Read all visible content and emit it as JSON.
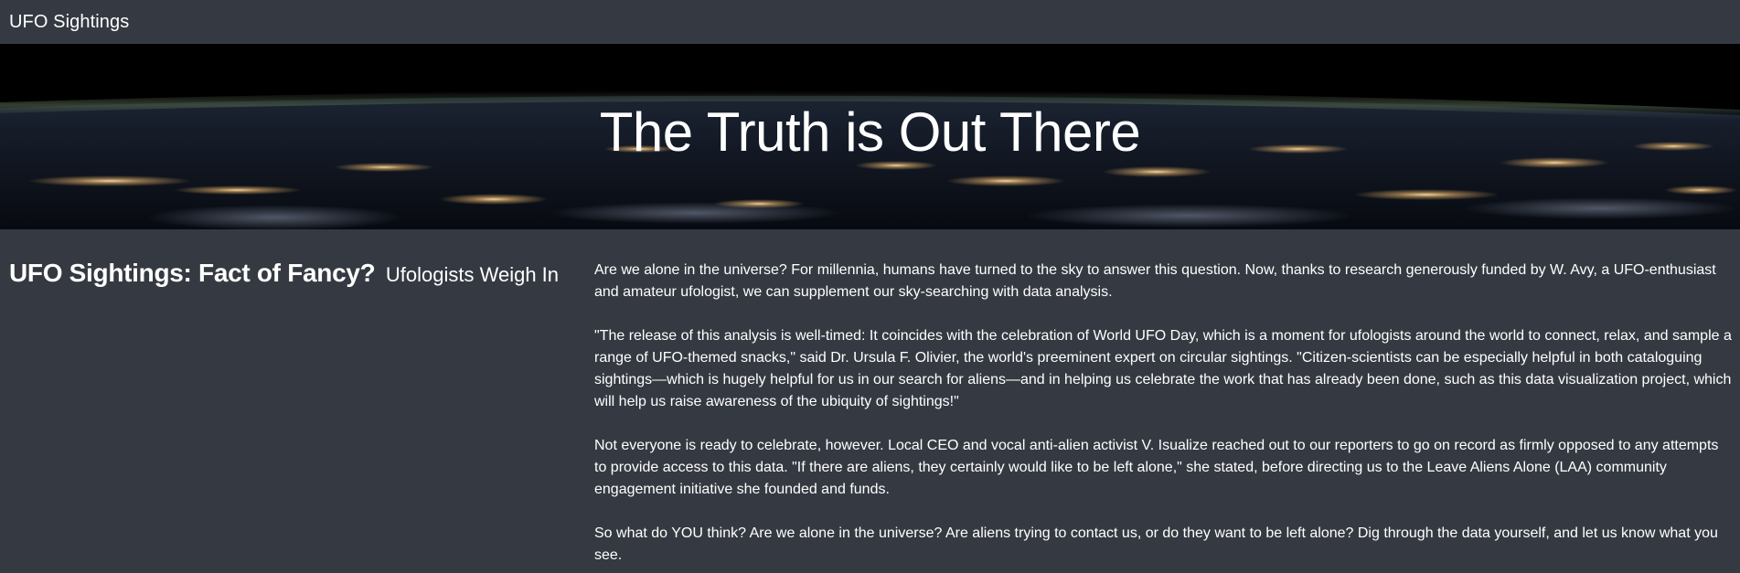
{
  "navbar": {
    "brand": "UFO Sightings"
  },
  "hero": {
    "title": "The Truth is Out There"
  },
  "article": {
    "heading": "UFO Sightings: Fact of Fancy?",
    "subheading": "Ufologists Weigh In",
    "paragraphs": [
      "Are we alone in the universe? For millennia, humans have turned to the sky to answer this question. Now, thanks to research generously funded by W. Avy, a UFO-enthusiast and amateur ufologist, we can supplement our sky-searching with data analysis.",
      "\"The release of this analysis is well-timed: It coincides with the celebration of World UFO Day, which is a moment for ufologists around the world to connect, relax, and sample a range of UFO-themed snacks,\" said Dr. Ursula F. Olivier, the world's preeminent expert on circular sightings. \"Citizen-scientists can be especially helpful in both cataloguing sightings—which is hugely helpful for us in our search for aliens—and in helping us celebrate the work that has already been done, such as this data visualization project, which will help us raise awareness of the ubiquity of sightings!\"",
      "Not everyone is ready to celebrate, however. Local CEO and vocal anti-alien activist V. Isualize reached out to our reporters to go on record as firmly opposed to any attempts to provide access to this data. \"If there are aliens, they certainly would like to be left alone,\" she stated, before directing us to the Leave Aliens Alone (LAA) community engagement initiative she founded and funds.",
      "So what do YOU think? Are we alone in the universe? Are aliens trying to contact us, or do they want to be left alone? Dig through the data yourself, and let us know what you see."
    ]
  }
}
